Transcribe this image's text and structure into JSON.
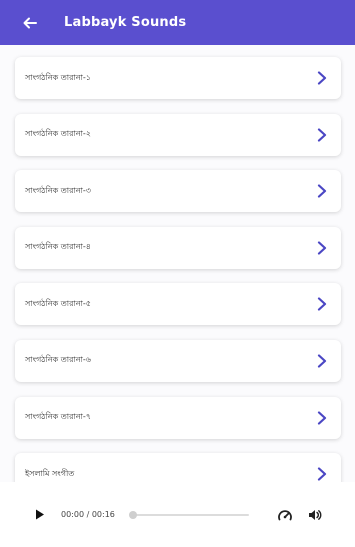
{
  "appbar": {
    "title": "Labbayk Sounds",
    "back_icon": "arrow-left-icon",
    "background": "#5a4fcf"
  },
  "list": {
    "items": [
      {
        "label": "সাংগঠনিক তারানা-১"
      },
      {
        "label": "সাংগঠনিক তারানা-২"
      },
      {
        "label": "সাংগঠনিক তারানা-৩"
      },
      {
        "label": "সাংগঠনিক তারানা-৪"
      },
      {
        "label": "সাংগঠনিক তারানা-৫"
      },
      {
        "label": "সাংগঠনিক তারানা-৬"
      },
      {
        "label": "সাংগঠনিক তারানা-৭"
      },
      {
        "label": "ইসলামি সংগীত"
      }
    ],
    "chevron_icon": "chevron-right-icon",
    "accent": "#4b47c4"
  },
  "player": {
    "time": "00:00 / 00:16",
    "progress": 0,
    "play_icon": "play-icon",
    "speed_icon": "speed-icon",
    "volume_icon": "volume-icon"
  }
}
